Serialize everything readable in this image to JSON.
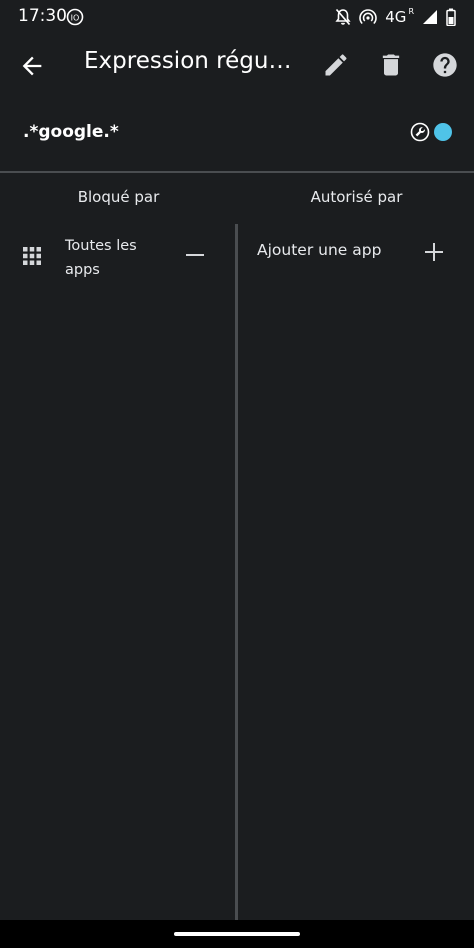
{
  "status_bar": {
    "time": "17:30",
    "network": "4G",
    "roaming": "R",
    "icons": [
      "io-icon",
      "bell-off-icon",
      "hotspot-icon",
      "signal-icon",
      "battery-icon"
    ]
  },
  "app_bar": {
    "title": "Expression régul…",
    "icons": {
      "back": "arrow-back-icon",
      "edit": "pencil-icon",
      "delete": "trash-icon",
      "help": "help-icon"
    }
  },
  "rule": {
    "pattern": ".*google.*",
    "status_color": "#4fc3e8"
  },
  "columns": {
    "blocked_header": "Bloqué par",
    "allowed_header": "Autorisé par"
  },
  "blocked_items": [
    {
      "label": "Toutes les apps",
      "icon": "apps-grid-icon"
    }
  ],
  "allowed_actions": {
    "add_label": "Ajouter une app"
  },
  "colors": {
    "background": "#1b1d1f",
    "divider": "#4a4d50",
    "accent": "#4fc3e8"
  }
}
